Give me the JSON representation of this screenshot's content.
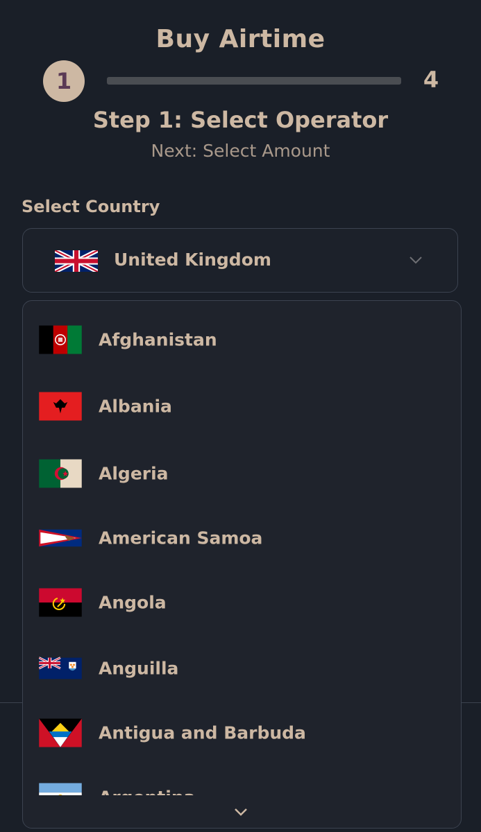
{
  "header": {
    "title": "Buy Airtime"
  },
  "stepper": {
    "current_step": "1",
    "total_steps": "4",
    "progress": 0.0,
    "step_title": "Step 1: Select Operator",
    "next_step": "Next: Select Amount"
  },
  "country_select": {
    "label": "Select Country",
    "selected": "United Kingdom",
    "selected_flag_icon": "uk-flag-icon"
  },
  "dropdown": {
    "options": [
      {
        "label": "Afghanistan",
        "flag_icon": "afghanistan-flag-icon"
      },
      {
        "label": "Albania",
        "flag_icon": "albania-flag-icon"
      },
      {
        "label": "Algeria",
        "flag_icon": "algeria-flag-icon"
      },
      {
        "label": "American Samoa",
        "flag_icon": "american-samoa-flag-icon"
      },
      {
        "label": "Angola",
        "flag_icon": "angola-flag-icon"
      },
      {
        "label": "Anguilla",
        "flag_icon": "anguilla-flag-icon"
      },
      {
        "label": "Antigua and Barbuda",
        "flag_icon": "antigua-barbuda-flag-icon"
      },
      {
        "label": "Argentina",
        "flag_icon": "argentina-flag-icon"
      }
    ]
  },
  "colors": {
    "background": "#1a1f28",
    "accent": "#cdb8a3",
    "panel": "#1f232c",
    "border": "#3c4350"
  }
}
